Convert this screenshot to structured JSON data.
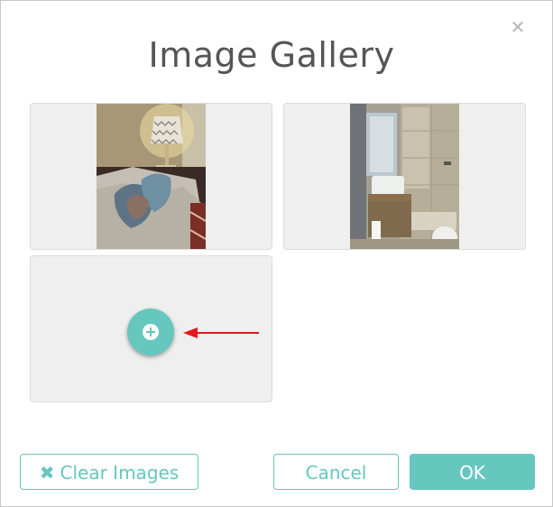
{
  "dialog": {
    "title": "Image Gallery",
    "close_icon": "close-icon"
  },
  "gallery": {
    "images": [
      {
        "description_icon": "living-room-photo"
      },
      {
        "description_icon": "bathroom-photo"
      }
    ],
    "add_icon": "plus-circle-icon"
  },
  "buttons": {
    "clear_label": "Clear Images",
    "clear_icon": "close-icon",
    "cancel_label": "Cancel",
    "ok_label": "OK"
  },
  "colors": {
    "accent": "#66c7bf",
    "annotation_arrow": "#e8161b"
  }
}
